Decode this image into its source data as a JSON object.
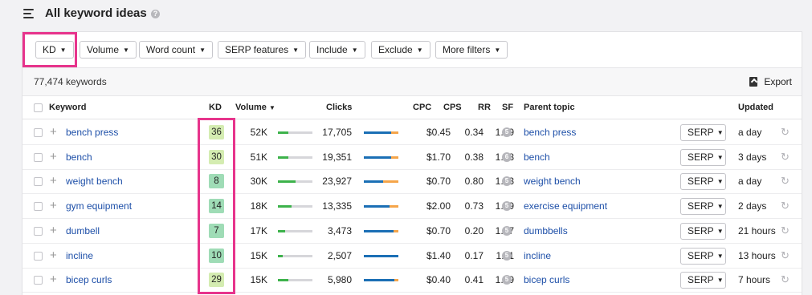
{
  "header": {
    "title": "All keyword ideas",
    "help_icon": "question-circle-icon"
  },
  "filters": [
    {
      "label": "KD"
    },
    {
      "label": "Volume"
    },
    {
      "label": "Word count"
    },
    {
      "label": "SERP features"
    },
    {
      "label": "Include"
    },
    {
      "label": "Exclude"
    },
    {
      "label": "More filters"
    }
  ],
  "toolbar": {
    "keyword_count": "77,474 keywords",
    "export_label": "Export"
  },
  "columns": {
    "keyword": "Keyword",
    "kd": "KD",
    "volume": "Volume",
    "clicks": "Clicks",
    "cpc": "CPC",
    "cps": "CPS",
    "rr": "RR",
    "sf": "SF",
    "parent_topic": "Parent topic",
    "updated": "Updated"
  },
  "colors": {
    "kd_light_green": "#d4ecb1",
    "kd_green": "#9fdcb6",
    "link": "#1d4fa8",
    "highlight": "#e7348c"
  },
  "rows": [
    {
      "keyword": "bench press",
      "kd": "36",
      "kd_color": "#d4ecb1",
      "volume": "52K",
      "volume_level": 0.3,
      "clicks": "17,705",
      "organic_share": 0.22,
      "cpc": "$0.45",
      "cps": "0.34",
      "rr": "1.19",
      "sf": "5",
      "parent_topic": "bench press",
      "serp": "SERP",
      "updated": "a day"
    },
    {
      "keyword": "bench",
      "kd": "30",
      "kd_color": "#d4ecb1",
      "volume": "51K",
      "volume_level": 0.3,
      "clicks": "19,351",
      "organic_share": 0.2,
      "cpc": "$1.70",
      "cps": "0.38",
      "rr": "1.18",
      "sf": "6",
      "parent_topic": "bench",
      "serp": "SERP",
      "updated": "3 days"
    },
    {
      "keyword": "weight bench",
      "kd": "8",
      "kd_color": "#9fdcb6",
      "volume": "30K",
      "volume_level": 0.5,
      "clicks": "23,927",
      "organic_share": 0.45,
      "cpc": "$0.70",
      "cps": "0.80",
      "rr": "1.33",
      "sf": "5",
      "parent_topic": "weight bench",
      "serp": "SERP",
      "updated": "a day"
    },
    {
      "keyword": "gym equipment",
      "kd": "14",
      "kd_color": "#9fdcb6",
      "volume": "18K",
      "volume_level": 0.4,
      "clicks": "13,335",
      "organic_share": 0.25,
      "cpc": "$2.00",
      "cps": "0.73",
      "rr": "1.19",
      "sf": "5",
      "parent_topic": "exercise equipment",
      "serp": "SERP",
      "updated": "2 days"
    },
    {
      "keyword": "dumbell",
      "kd": "7",
      "kd_color": "#9fdcb6",
      "volume": "17K",
      "volume_level": 0.2,
      "clicks": "3,473",
      "organic_share": 0.15,
      "cpc": "$0.70",
      "cps": "0.20",
      "rr": "1.07",
      "sf": "5",
      "parent_topic": "dumbbells",
      "serp": "SERP",
      "updated": "21 hours"
    },
    {
      "keyword": "incline",
      "kd": "10",
      "kd_color": "#9fdcb6",
      "volume": "15K",
      "volume_level": 0.15,
      "clicks": "2,507",
      "organic_share": 0.0,
      "cpc": "$1.40",
      "cps": "0.17",
      "rr": "1.11",
      "sf": "5",
      "parent_topic": "incline",
      "serp": "SERP",
      "updated": "13 hours"
    },
    {
      "keyword": "bicep curls",
      "kd": "29",
      "kd_color": "#d4ecb1",
      "volume": "15K",
      "volume_level": 0.3,
      "clicks": "5,980",
      "organic_share": 0.12,
      "cpc": "$0.40",
      "cps": "0.41",
      "rr": "1.19",
      "sf": "5",
      "parent_topic": "bicep curls",
      "serp": "SERP",
      "updated": "7 hours"
    }
  ]
}
